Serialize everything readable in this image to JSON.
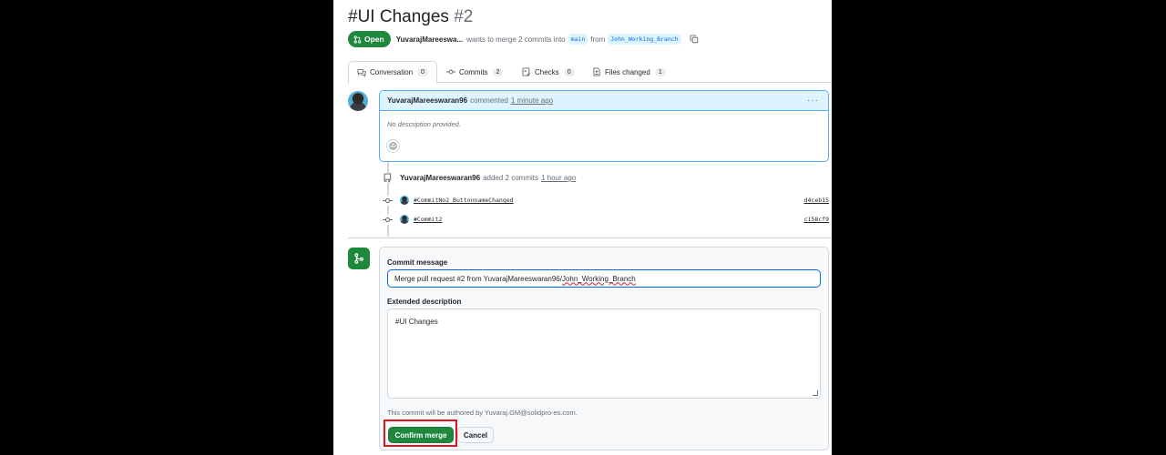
{
  "pr": {
    "title": "#UI Changes",
    "number": "#2",
    "state": "Open",
    "author": "YuvarajMareeswa...",
    "summary_prefix": "wants to merge 2 commits into",
    "base_branch": "main",
    "from_word": "from",
    "head_branch": "John_Working_Branch"
  },
  "tabs": [
    {
      "label": "Conversation",
      "count": "0"
    },
    {
      "label": "Commits",
      "count": "2"
    },
    {
      "label": "Checks",
      "count": "0"
    },
    {
      "label": "Files changed",
      "count": "1"
    }
  ],
  "comment": {
    "author": "YuvarajMareeswaran96",
    "action": "commented",
    "time": "1 minute ago",
    "body": "No description provided."
  },
  "commit_event": {
    "author": "YuvarajMareeswaran96",
    "action": "added 2 commits",
    "time": "1 hour ago",
    "commits": [
      {
        "message": "#CommitNo2_ButtonnameChanged",
        "sha": "d4ceb15"
      },
      {
        "message": "#Commit2",
        "sha": "c158cf9"
      }
    ]
  },
  "merge": {
    "commit_message_label": "Commit message",
    "commit_message_main": "Merge pull request #2 from YuvarajMareeswaran96/",
    "commit_message_branch": "John_Working_Branch",
    "extended_description_label": "Extended description",
    "extended_description_value": "#UI Changes",
    "author_note": "This commit will be authored by Yuvaraj.GM@solidpro-es.com.",
    "confirm_label": "Confirm merge",
    "cancel_label": "Cancel"
  },
  "colors": {
    "success": "#1f883d",
    "accent": "#0969da",
    "highlight": "#e0141e"
  }
}
